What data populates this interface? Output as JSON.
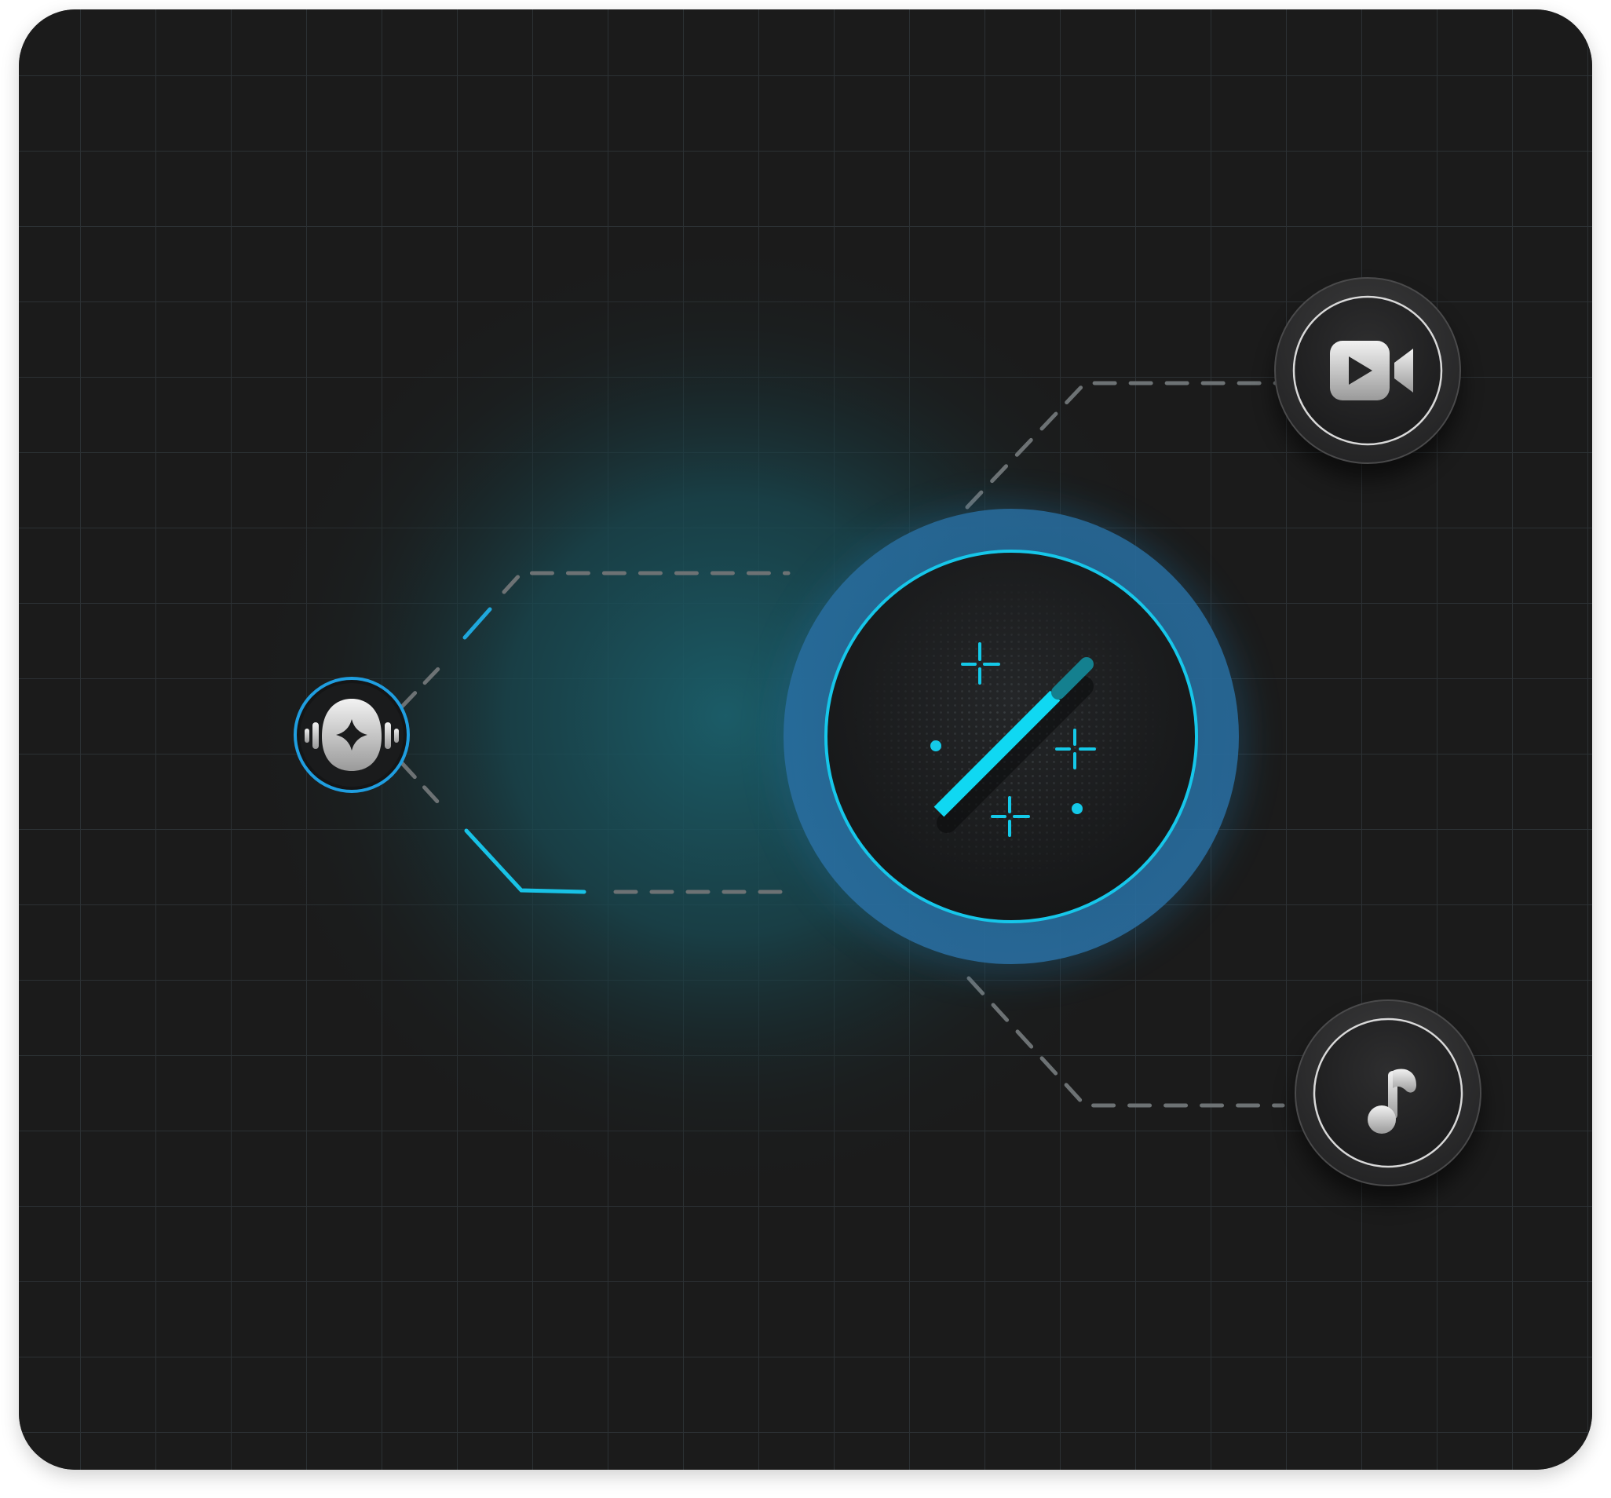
{
  "colors": {
    "background": "#1b1b1b",
    "grid": "#2c3134",
    "accent": "#0fd6f0",
    "accent_ring": "#2a6fa3",
    "glow": "#165a68",
    "connector": "#6d7274",
    "icon_fill": "#e8e8e8"
  },
  "nodes": {
    "center": {
      "icon": "magic-wand-icon",
      "role": "hub",
      "active": true
    },
    "left": {
      "icon": "ai-audio-sparkle-icon",
      "active": true
    },
    "top_right": {
      "icon": "video-camera-icon",
      "active": false
    },
    "bottom_right": {
      "icon": "music-note-icon",
      "active": false
    }
  }
}
